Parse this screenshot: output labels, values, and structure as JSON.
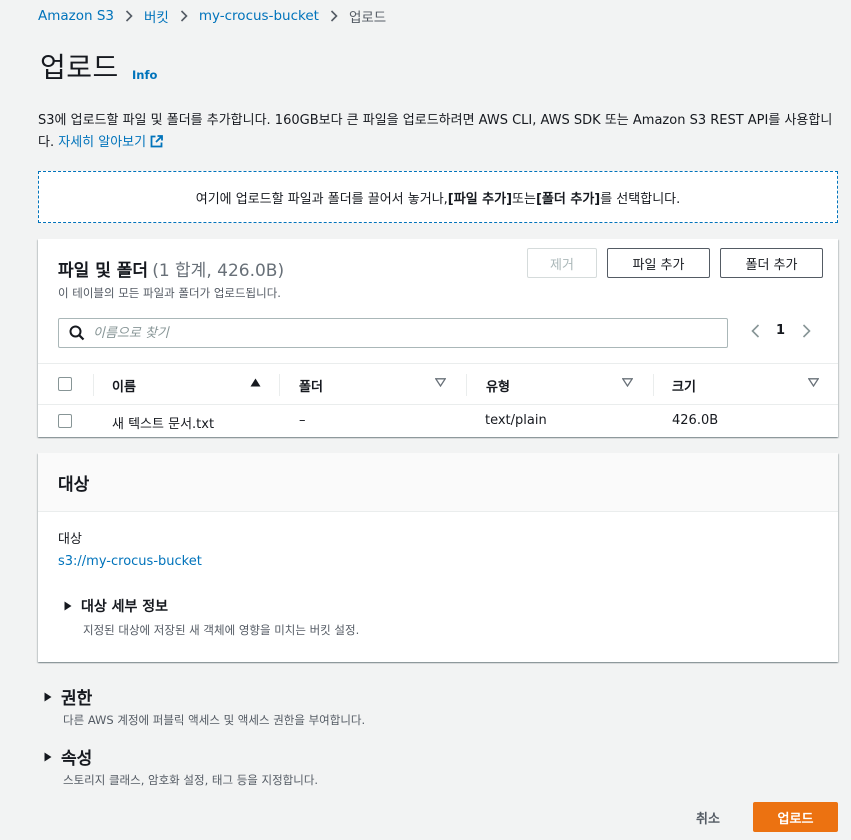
{
  "breadcrumb": {
    "items": [
      "Amazon S3",
      "버킷",
      "my-crocus-bucket"
    ],
    "current": "업로드"
  },
  "page": {
    "title": "업로드",
    "info": "Info",
    "description": "S3에 업로드할 파일 및 폴더를 추가합니다. 160GB보다 큰 파일을 업로드하려면 AWS CLI, AWS SDK 또는 Amazon S3 REST API를 사용합니다.",
    "learn_more": "자세히 알아보기"
  },
  "dropzone": {
    "prefix": "여기에 업로드할 파일과 폴더를 끌어서 놓거나, ",
    "add_files": "[파일 추가]",
    "middle": " 또는 ",
    "add_folder": "[폴더 추가]",
    "suffix": "를 선택합니다."
  },
  "files": {
    "title": "파일 및 폴더",
    "count": "(1 합계, 426.0B)",
    "subtitle": "이 테이블의 모든 파일과 폴더가 업로드됩니다.",
    "remove_label": "제거",
    "add_files_label": "파일 추가",
    "add_folder_label": "폴더 추가",
    "search_placeholder": "이름으로 찾기",
    "page": "1",
    "columns": [
      "이름",
      "폴더",
      "유형",
      "크기"
    ],
    "rows": [
      {
        "name": "새 텍스트 문서.txt",
        "folder": "–",
        "type": "text/plain",
        "size": "426.0B"
      }
    ]
  },
  "destination": {
    "title": "대상",
    "label": "대상",
    "value": "s3://my-crocus-bucket",
    "details_title": "대상 세부 정보",
    "details_sub": "지정된 대상에 저장된 새 객체에 영향을 미치는 버킷 설정."
  },
  "permissions": {
    "title": "권한",
    "sub": "다른 AWS 계정에 퍼블릭 액세스 및 액세스 권한을 부여합니다."
  },
  "properties": {
    "title": "속성",
    "sub": "스토리지 클래스, 암호화 설정, 태그 등을 지정합니다."
  },
  "actions": {
    "cancel": "취소",
    "upload": "업로드"
  },
  "colors": {
    "link": "#0073bb",
    "primary_button": "#ec7211",
    "background": "#f2f3f3"
  }
}
